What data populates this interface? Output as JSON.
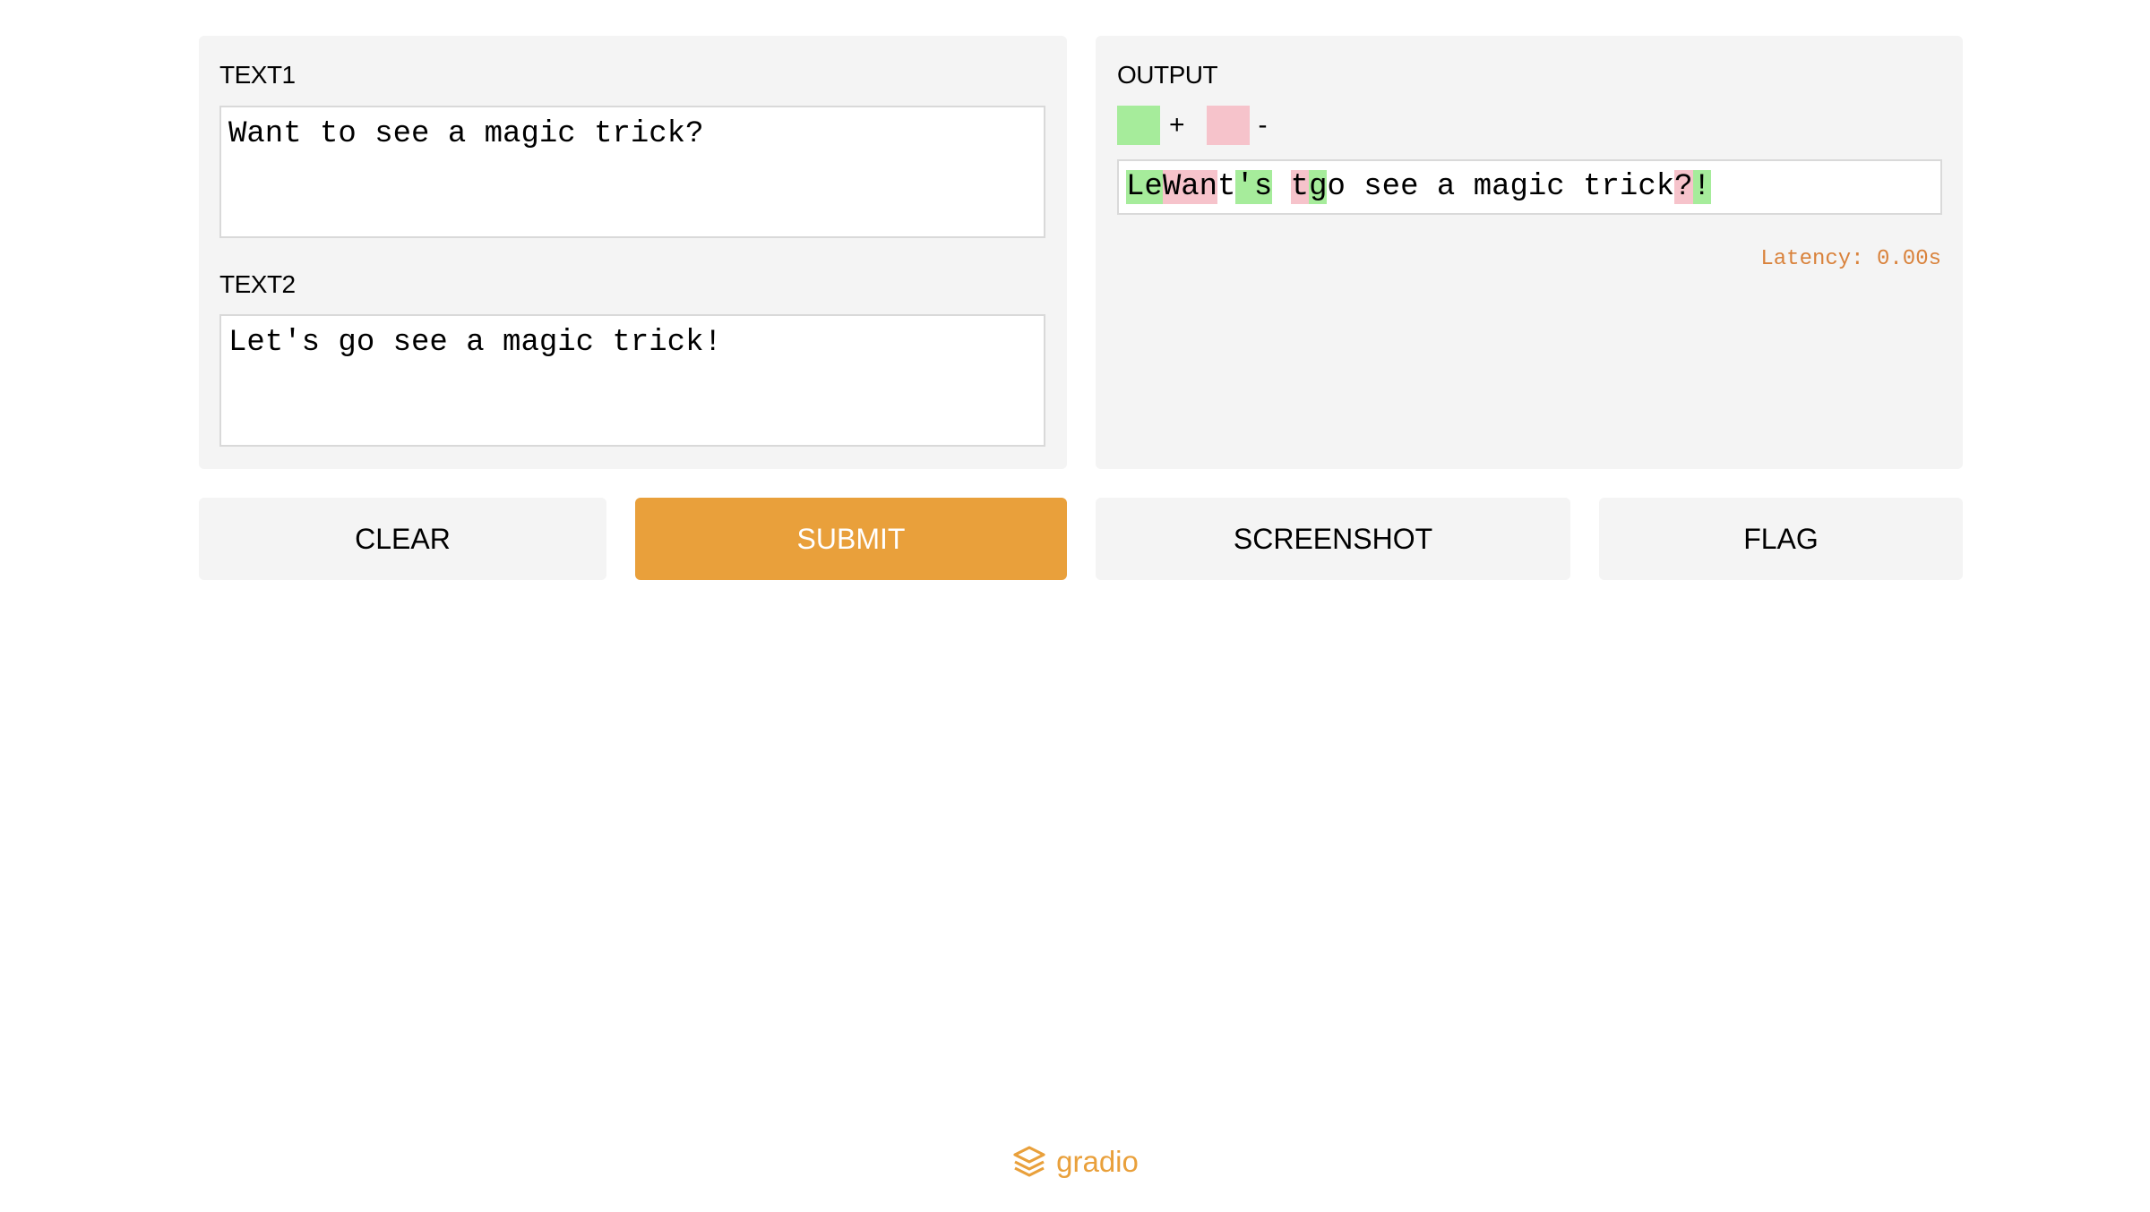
{
  "inputs": {
    "text1": {
      "label": "TEXT1",
      "value": "Want to see a magic trick?"
    },
    "text2": {
      "label": "TEXT2",
      "value": "Let's go see a magic trick!"
    }
  },
  "output": {
    "label": "OUTPUT",
    "legend": {
      "add_symbol": "+",
      "remove_symbol": "-",
      "add_color": "#a6ec9b",
      "remove_color": "#f6c3cb"
    },
    "segments": [
      {
        "text": "Le",
        "type": "add"
      },
      {
        "text": "Wan",
        "type": "remove"
      },
      {
        "text": "t",
        "type": "equal"
      },
      {
        "text": "'s",
        "type": "add"
      },
      {
        "text": " ",
        "type": "equal"
      },
      {
        "text": "t",
        "type": "remove"
      },
      {
        "text": "g",
        "type": "add"
      },
      {
        "text": "o see a magic trick",
        "type": "equal"
      },
      {
        "text": "?",
        "type": "remove"
      },
      {
        "text": "!",
        "type": "add"
      }
    ],
    "latency": "Latency: 0.00s",
    "latency_color": "#d9823b"
  },
  "buttons": {
    "clear": "CLEAR",
    "submit": "SUBMIT",
    "screenshot": "SCREENSHOT",
    "flag": "FLAG"
  },
  "colors": {
    "accent": "#e9a03b",
    "panel_bg": "#f4f4f4"
  },
  "footer": {
    "brand": "gradio",
    "icon": "gradio-logo-icon"
  }
}
